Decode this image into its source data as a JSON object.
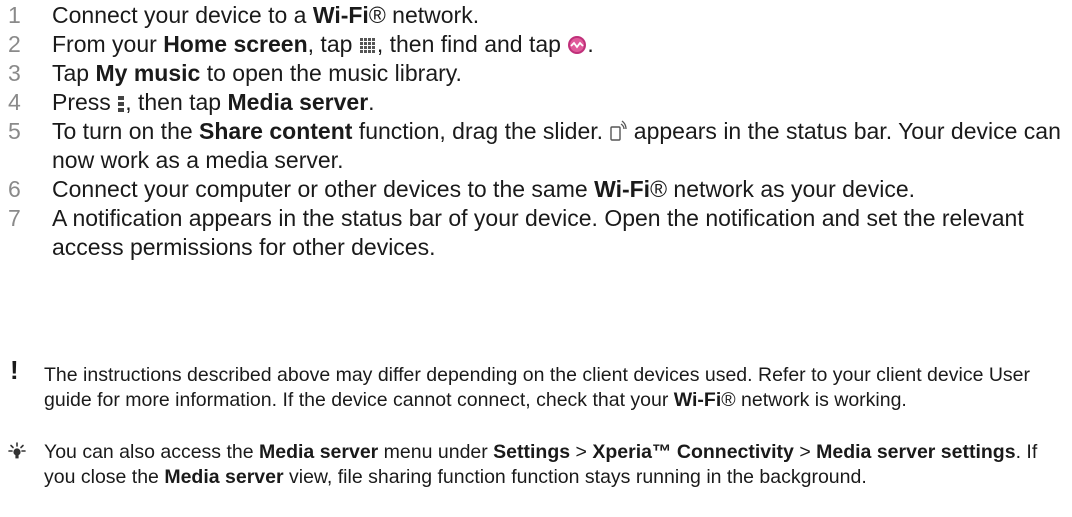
{
  "steps": [
    {
      "num": "1",
      "parts": [
        {
          "t": "Connect your device to a "
        },
        {
          "t": "Wi-Fi",
          "b": true
        },
        {
          "t": "® network."
        }
      ]
    },
    {
      "num": "2",
      "parts": [
        {
          "t": "From your "
        },
        {
          "t": "Home screen",
          "b": true
        },
        {
          "t": ", tap "
        },
        {
          "icon": "apps-grid-icon"
        },
        {
          "t": ", then find and tap "
        },
        {
          "icon": "walkman-music-icon"
        },
        {
          "t": "."
        }
      ]
    },
    {
      "num": "3",
      "parts": [
        {
          "t": "Tap "
        },
        {
          "t": "My music",
          "b": true
        },
        {
          "t": " to open the music library."
        }
      ]
    },
    {
      "num": "4",
      "parts": [
        {
          "t": "Press "
        },
        {
          "icon": "menu-key-icon"
        },
        {
          "t": ", then tap "
        },
        {
          "t": "Media server",
          "b": true
        },
        {
          "t": "."
        }
      ]
    },
    {
      "num": "5",
      "parts": [
        {
          "t": "To turn on the "
        },
        {
          "t": "Share content",
          "b": true
        },
        {
          "t": " function, drag the slider. "
        },
        {
          "icon": "media-share-status-icon"
        },
        {
          "t": " appears in the status bar. Your device can now work as a media server."
        }
      ]
    },
    {
      "num": "6",
      "parts": [
        {
          "t": "Connect your computer or other devices to the same "
        },
        {
          "t": "Wi-Fi",
          "b": true
        },
        {
          "t": "® network as your device."
        }
      ]
    },
    {
      "num": "7",
      "parts": [
        {
          "t": "A notification appears in the status bar of your device. Open the notification and set the relevant access permissions for other devices."
        }
      ]
    }
  ],
  "warning_note": {
    "icon": "exclamation-icon",
    "symbol": "!",
    "parts": [
      {
        "t": "The instructions described above may differ depending on the client devices used. Refer to your client device User guide for more information. If the device cannot connect, check that your "
      },
      {
        "t": "Wi-Fi",
        "b": true
      },
      {
        "t": "® network is working."
      }
    ]
  },
  "tip_note": {
    "icon": "lightbulb-tip-icon",
    "parts": [
      {
        "t": "You can also access the "
      },
      {
        "t": "Media server",
        "b": true
      },
      {
        "t": " menu under "
      },
      {
        "t": "Settings",
        "b": true
      },
      {
        "t": " > "
      },
      {
        "t": "Xperia™ Connectivity",
        "b": true
      },
      {
        "t": " > "
      },
      {
        "t": "Media server settings",
        "b": true
      },
      {
        "t": ". If you close the "
      },
      {
        "t": "Media server",
        "b": true
      },
      {
        "t": " view, file sharing function function stays running in the background."
      }
    ]
  },
  "colors": {
    "text": "#1a1a1a",
    "step_number": "#8a8a8a",
    "music_icon": "#c0307a"
  }
}
